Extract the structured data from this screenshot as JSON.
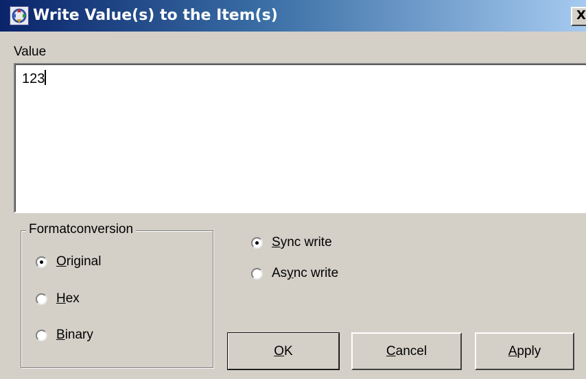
{
  "window": {
    "title": "Write Value(s) to the Item(s)",
    "close_glyph": "X",
    "icon": "app-dialog-icon"
  },
  "value_section": {
    "label": "Value",
    "text": "123"
  },
  "format_conversion": {
    "title": "Formatconversion",
    "options": [
      {
        "accel": "O",
        "rest": "riginal",
        "checked": true
      },
      {
        "accel": "H",
        "rest": "ex",
        "checked": false
      },
      {
        "accel": "B",
        "rest": "inary",
        "checked": false
      }
    ]
  },
  "write_mode": {
    "options": [
      {
        "accel": "S",
        "rest": "ync write",
        "checked": true
      },
      {
        "pre": "As",
        "accel": "y",
        "rest": "nc write",
        "checked": false
      }
    ]
  },
  "buttons": {
    "ok": {
      "accel": "O",
      "rest": "K"
    },
    "cancel": {
      "accel": "C",
      "rest": "ancel"
    },
    "apply": {
      "accel": "A",
      "rest": "pply"
    }
  },
  "colors": {
    "titlebar_start": "#0a246a",
    "titlebar_end": "#a6caf0",
    "face": "#d4d0c8"
  }
}
